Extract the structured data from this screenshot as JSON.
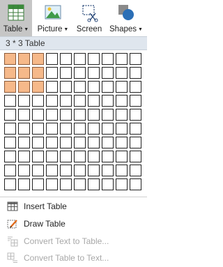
{
  "ribbon": {
    "table_label": "Table",
    "picture_label": "Picture",
    "screen_label": "Screen",
    "shapes_label": "Shapes",
    "icons": [
      "table-icon",
      "picture-icon",
      "screen-clip-icon",
      "shapes-icon"
    ]
  },
  "grid": {
    "header": "3 * 3 Table",
    "rows": 10,
    "cols": 10,
    "selected_rows": 3,
    "selected_cols": 3,
    "selected_color": "#f6b98a"
  },
  "menu": {
    "insert_table": "Insert Table",
    "draw_table": "Draw Table",
    "convert_text_to_table": "Convert Text to Table...",
    "convert_table_to_text": "Convert Table to Text..."
  }
}
